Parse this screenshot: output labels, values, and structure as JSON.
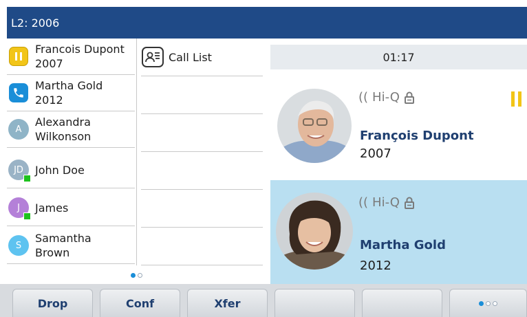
{
  "title": "L2: 2006",
  "line_keys": [
    {
      "name_line1": "Francois Dupont",
      "name_line2": "2007",
      "icon": "hold-icon",
      "avatar_letter": ""
    },
    {
      "name_line1": "Martha Gold",
      "name_line2": "2012",
      "icon": "handset-icon",
      "avatar_letter": ""
    },
    {
      "name_line1": "Alexandra",
      "name_line2": "Wilkonson",
      "icon": "contact-avatar",
      "avatar_letter": "A"
    },
    {
      "name_line1": "John Doe",
      "name_line2": "",
      "icon": "contact-avatar",
      "avatar_letter": "JD"
    },
    {
      "name_line1": "James",
      "name_line2": "",
      "icon": "contact-avatar",
      "avatar_letter": "J"
    },
    {
      "name_line1": "Samantha",
      "name_line2": "Brown",
      "icon": "contact-avatar",
      "avatar_letter": "S"
    }
  ],
  "middle": {
    "call_list_label": "Call List"
  },
  "call_timer": "01:17",
  "calls": [
    {
      "name": "François Dupont",
      "number": "2007",
      "audio_label": "Hi-Q",
      "state": "hold"
    },
    {
      "name": "Martha Gold",
      "number": "2012",
      "audio_label": "Hi-Q",
      "state": "active"
    }
  ],
  "softkeys": [
    "Drop",
    "Conf",
    "Xfer",
    "",
    "",
    ""
  ],
  "colors": {
    "titlebar": "#1f4a87",
    "hold_yellow": "#f2c518",
    "call_blue": "#1a8ed8",
    "active_call_bg": "#b9dff1",
    "presence_green": "#1ec21e",
    "avatar_A": "#8fb4c7",
    "avatar_JD": "#9ab3c6",
    "avatar_J": "#b480d8",
    "avatar_S": "#5ec3f0"
  }
}
